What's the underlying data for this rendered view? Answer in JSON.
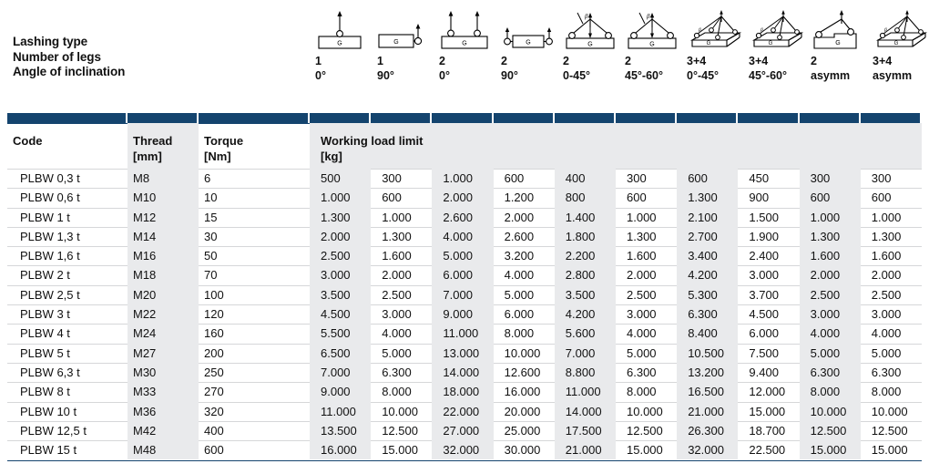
{
  "legend": {
    "labels": [
      "Lashing type",
      "Number of legs",
      "Angle of inclination"
    ],
    "configurations": [
      {
        "icon": "single-leg-vertical-icon",
        "legs": "1",
        "angle": "0°",
        "load_label": "G"
      },
      {
        "icon": "single-leg-horizontal-icon",
        "legs": "1",
        "angle": "90°",
        "load_label": "G"
      },
      {
        "icon": "two-leg-vertical-icon",
        "legs": "2",
        "angle": "0°",
        "load_label": "G"
      },
      {
        "icon": "two-leg-horizontal-icon",
        "legs": "2",
        "angle": "90°",
        "load_label": "G"
      },
      {
        "icon": "two-leg-inclined-low-icon",
        "legs": "2",
        "angle": "0-45°",
        "load_label": "G"
      },
      {
        "icon": "two-leg-inclined-high-icon",
        "legs": "2",
        "angle": "45°-60°",
        "load_label": "G"
      },
      {
        "icon": "four-leg-inclined-low-icon",
        "legs": "3+4",
        "angle": "0°-45°",
        "load_label": "G"
      },
      {
        "icon": "four-leg-inclined-high-icon",
        "legs": "3+4",
        "angle": "45°-60°",
        "load_label": "G"
      },
      {
        "icon": "two-leg-asymmetric-icon",
        "legs": "2",
        "angle": "asymm",
        "load_label": "G"
      },
      {
        "icon": "four-leg-asymmetric-icon",
        "legs": "3+4",
        "angle": "asymm",
        "load_label": "G"
      }
    ]
  },
  "table": {
    "headers": {
      "code": [
        "Code"
      ],
      "thread": [
        "Thread",
        "[mm]"
      ],
      "torque": [
        "Torque",
        "[Nm]"
      ],
      "wll": [
        "Working load limit",
        "[kg]"
      ]
    },
    "rows": [
      {
        "code": "PLBW 0,3 t",
        "thread": "M8",
        "torque": "6",
        "wll": [
          "500",
          "300",
          "1.000",
          "600",
          "400",
          "300",
          "600",
          "450",
          "300",
          "300"
        ]
      },
      {
        "code": "PLBW 0,6 t",
        "thread": "M10",
        "torque": "10",
        "wll": [
          "1.000",
          "600",
          "2.000",
          "1.200",
          "800",
          "600",
          "1.300",
          "900",
          "600",
          "600"
        ]
      },
      {
        "code": "PLBW 1 t",
        "thread": "M12",
        "torque": "15",
        "wll": [
          "1.300",
          "1.000",
          "2.600",
          "2.000",
          "1.400",
          "1.000",
          "2.100",
          "1.500",
          "1.000",
          "1.000"
        ]
      },
      {
        "code": "PLBW 1,3 t",
        "thread": "M14",
        "torque": "30",
        "wll": [
          "2.000",
          "1.300",
          "4.000",
          "2.600",
          "1.800",
          "1.300",
          "2.700",
          "1.900",
          "1.300",
          "1.300"
        ]
      },
      {
        "code": "PLBW 1,6 t",
        "thread": "M16",
        "torque": "50",
        "wll": [
          "2.500",
          "1.600",
          "5.000",
          "3.200",
          "2.200",
          "1.600",
          "3.400",
          "2.400",
          "1.600",
          "1.600"
        ]
      },
      {
        "code": "PLBW 2 t",
        "thread": "M18",
        "torque": "70",
        "wll": [
          "3.000",
          "2.000",
          "6.000",
          "4.000",
          "2.800",
          "2.000",
          "4.200",
          "3.000",
          "2.000",
          "2.000"
        ]
      },
      {
        "code": "PLBW 2,5 t",
        "thread": "M20",
        "torque": "100",
        "wll": [
          "3.500",
          "2.500",
          "7.000",
          "5.000",
          "3.500",
          "2.500",
          "5.300",
          "3.700",
          "2.500",
          "2.500"
        ]
      },
      {
        "code": "PLBW 3 t",
        "thread": "M22",
        "torque": "120",
        "wll": [
          "4.500",
          "3.000",
          "9.000",
          "6.000",
          "4.200",
          "3.000",
          "6.300",
          "4.500",
          "3.000",
          "3.000"
        ]
      },
      {
        "code": "PLBW 4 t",
        "thread": "M24",
        "torque": "160",
        "wll": [
          "5.500",
          "4.000",
          "11.000",
          "8.000",
          "5.600",
          "4.000",
          "8.400",
          "6.000",
          "4.000",
          "4.000"
        ]
      },
      {
        "code": "PLBW 5 t",
        "thread": "M27",
        "torque": "200",
        "wll": [
          "6.500",
          "5.000",
          "13.000",
          "10.000",
          "7.000",
          "5.000",
          "10.500",
          "7.500",
          "5.000",
          "5.000"
        ]
      },
      {
        "code": "PLBW 6,3 t",
        "thread": "M30",
        "torque": "250",
        "wll": [
          "7.000",
          "6.300",
          "14.000",
          "12.600",
          "8.800",
          "6.300",
          "13.200",
          "9.400",
          "6.300",
          "6.300"
        ]
      },
      {
        "code": "PLBW 8 t",
        "thread": "M33",
        "torque": "270",
        "wll": [
          "9.000",
          "8.000",
          "18.000",
          "16.000",
          "11.000",
          "8.000",
          "16.500",
          "12.000",
          "8.000",
          "8.000"
        ]
      },
      {
        "code": "PLBW 10 t",
        "thread": "M36",
        "torque": "320",
        "wll": [
          "11.000",
          "10.000",
          "22.000",
          "20.000",
          "14.000",
          "10.000",
          "21.000",
          "15.000",
          "10.000",
          "10.000"
        ]
      },
      {
        "code": "PLBW 12,5 t",
        "thread": "M42",
        "torque": "400",
        "wll": [
          "13.500",
          "12.500",
          "27.000",
          "25.000",
          "17.500",
          "12.500",
          "26.300",
          "18.700",
          "12.500",
          "12.500"
        ]
      },
      {
        "code": "PLBW 15 t",
        "thread": "M48",
        "torque": "600",
        "wll": [
          "16.000",
          "15.000",
          "32.000",
          "30.000",
          "21.000",
          "15.000",
          "32.000",
          "22.500",
          "15.000",
          "15.000"
        ]
      }
    ]
  },
  "colors": {
    "header_bar": "#14446e",
    "header_fill": "#e9eaec",
    "column_shade": "#e9eaec",
    "row_separator": "#d6d7d9",
    "text": "#111111"
  }
}
